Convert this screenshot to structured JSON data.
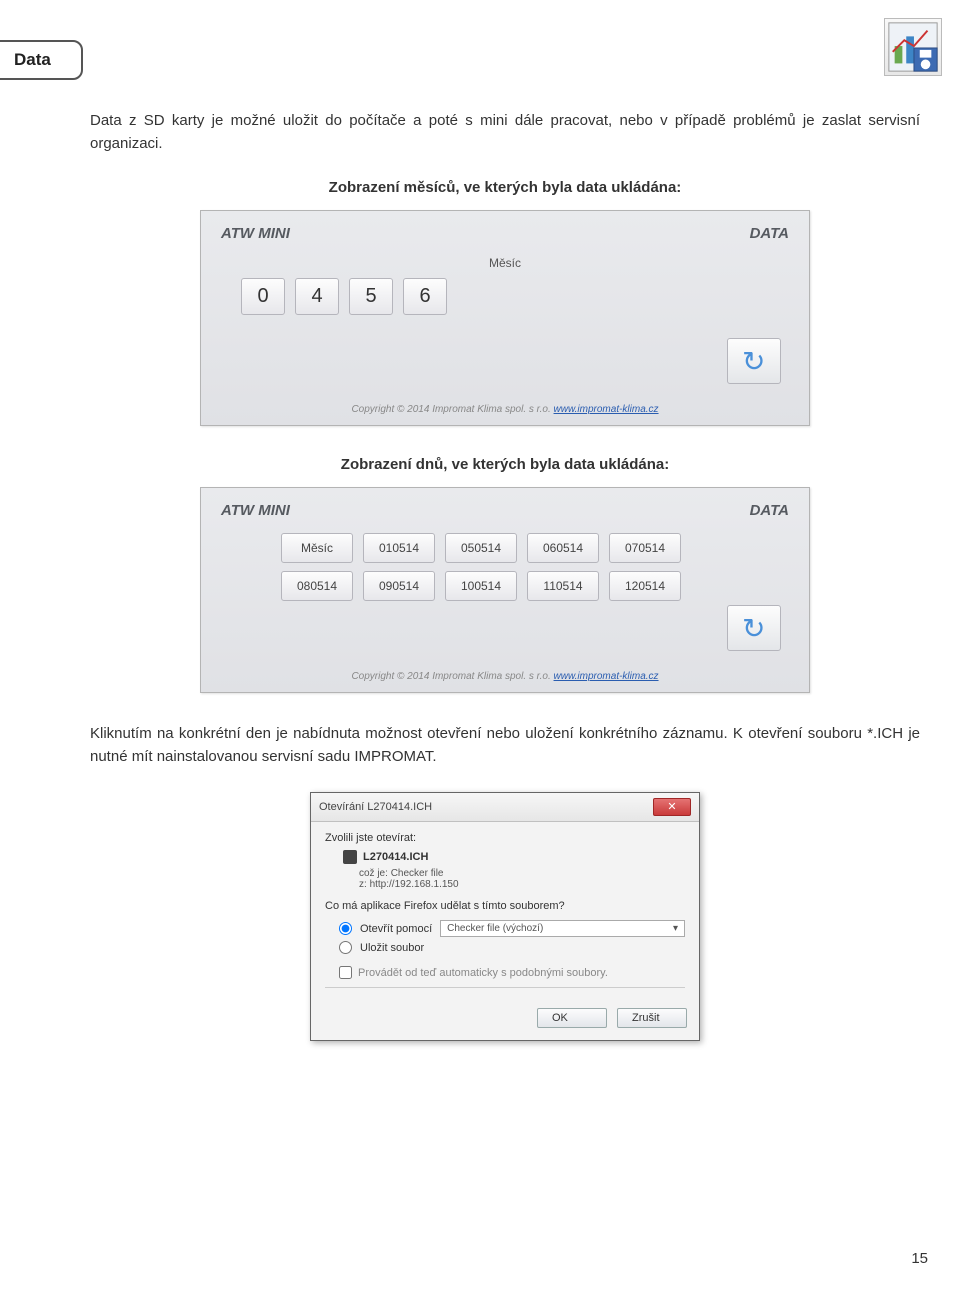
{
  "section": {
    "title": "Data"
  },
  "intro": "Data z SD karty je možné uložit do počítače a poté s mini dále pracovat, nebo v případě problémů je zaslat servisní organizaci.",
  "panel1": {
    "heading": "Zobrazení měsíců, ve kterých byla data ukládána:",
    "title_left": "ATW MINI",
    "title_right": "DATA",
    "label": "Měsíc",
    "buttons": [
      "0",
      "4",
      "5",
      "6"
    ],
    "copyright": "Copyright © 2014 Impromat Klima spol. s r.o.",
    "link": "www.impromat-klima.cz"
  },
  "panel2": {
    "heading": "Zobrazení dnů, ve kterých byla data ukládána:",
    "title_left": "ATW MINI",
    "title_right": "DATA",
    "row1": [
      "Měsíc",
      "010514",
      "050514",
      "060514",
      "070514"
    ],
    "row2": [
      "080514",
      "090514",
      "100514",
      "110514",
      "120514"
    ],
    "copyright": "Copyright © 2014 Impromat Klima spol. s r.o.",
    "link": "www.impromat-klima.cz"
  },
  "para2": "Kliknutím na konkrétní den je nabídnuta možnost otevření nebo uložení konkrétního záznamu. K otevření souboru *.ICH je nutné mít nainstalovanou servisní sadu IMPROMAT.",
  "dialog": {
    "title": "Otevírání L270414.ICH",
    "intro": "Zvolili jste otevírat:",
    "filename": "L270414.ICH",
    "type_label": "což je:",
    "type_value": "Checker file",
    "from_label": "z:",
    "from_value": "http://192.168.1.150",
    "question": "Co má aplikace Firefox udělat s tímto souborem?",
    "open_label": "Otevřít pomocí",
    "open_value": "Checker file (výchozí)",
    "save_label": "Uložit soubor",
    "remember": "Provádět od teď automaticky s podobnými soubory.",
    "ok": "OK",
    "cancel": "Zrušit"
  },
  "page_number": "15"
}
